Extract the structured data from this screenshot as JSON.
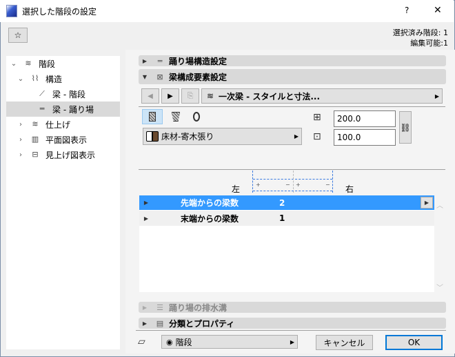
{
  "window": {
    "title": "選択した階段の設定",
    "help": "?",
    "close": "✕"
  },
  "header": {
    "selected": "選択済み階段: 1",
    "editable": "編集可能:1"
  },
  "tree": [
    {
      "label": "階段",
      "icon": "stair-icon",
      "expand": "⌄"
    },
    {
      "label": "構造",
      "icon": "structure-icon",
      "expand": "⌄"
    },
    {
      "label": "梁 - 階段",
      "icon": "stringer-flight-icon",
      "expand": ""
    },
    {
      "label": "梁 - 踊り場",
      "icon": "stringer-landing-icon",
      "expand": ""
    },
    {
      "label": "仕上げ",
      "icon": "finish-icon",
      "expand": "›"
    },
    {
      "label": "平面図表示",
      "icon": "floor-plan-icon",
      "expand": "›"
    },
    {
      "label": "見上げ図表示",
      "icon": "ceiling-plan-icon",
      "expand": "›"
    }
  ],
  "sections": {
    "landing_structure": "踊り場構造設定",
    "stringer_component": "梁構成要素設定",
    "landing_drainage": "踊り場の排水溝",
    "classification": "分類とプロパティ"
  },
  "stringer": {
    "style_dropdown": "一次梁 - スタイルと寸法...",
    "material": "床材-寄木張り",
    "material_color": "#6b4a2e",
    "width": "200.0",
    "height": "100.0",
    "left_label": "左",
    "right_label": "右",
    "plus": "+",
    "minus": "−"
  },
  "table": [
    {
      "label": "先端からの梁数",
      "value": "2",
      "selected": true
    },
    {
      "label": "末端からの梁数",
      "value": "1",
      "selected": false
    }
  ],
  "footer": {
    "layer": "階段",
    "cancel": "キャンセル",
    "ok": "OK"
  },
  "colors": {
    "selection": "#3399ff",
    "ok_border": "#0078d7"
  }
}
